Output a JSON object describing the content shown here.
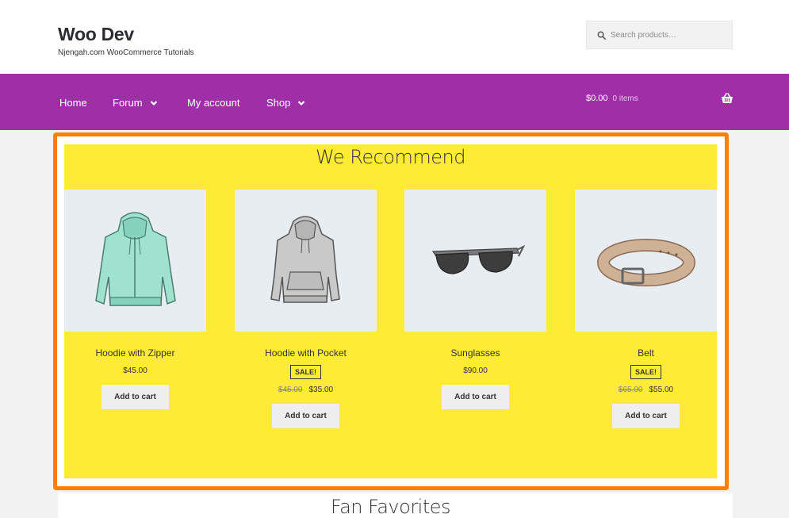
{
  "header": {
    "site_title": "Woo Dev",
    "site_description": "Njengah.com WooCommerce Tutorials",
    "search_placeholder": "Search products…"
  },
  "nav": {
    "items": [
      {
        "label": "Home",
        "has_dropdown": false
      },
      {
        "label": "Forum",
        "has_dropdown": true
      },
      {
        "label": "My account",
        "has_dropdown": false
      },
      {
        "label": "Shop",
        "has_dropdown": true
      }
    ],
    "cart_total": "$0.00",
    "cart_items": "0 items"
  },
  "recommend": {
    "title": "We Recommend",
    "products": [
      {
        "name": "Hoodie with Zipper",
        "price": "$45.00",
        "on_sale": false,
        "button": "Add to cart",
        "icon": "hoodie-zipper-image"
      },
      {
        "name": "Hoodie with Pocket",
        "sale_badge": "SALE!",
        "old_price": "$45.00",
        "price": "$35.00",
        "on_sale": true,
        "button": "Add to cart",
        "icon": "hoodie-pocket-image"
      },
      {
        "name": "Sunglasses",
        "price": "$90.00",
        "on_sale": false,
        "button": "Add to cart",
        "icon": "sunglasses-image"
      },
      {
        "name": "Belt",
        "sale_badge": "SALE!",
        "old_price": "$65.00",
        "price": "$55.00",
        "on_sale": true,
        "button": "Add to cart",
        "icon": "belt-image"
      }
    ]
  },
  "fan_favorites": {
    "title": "Fan Favorites"
  },
  "colors": {
    "nav_bg": "#9f2fa6",
    "highlight_frame": "#ff7f00",
    "section_bg": "#feeb35",
    "page_bg": "#f2f2f2"
  }
}
